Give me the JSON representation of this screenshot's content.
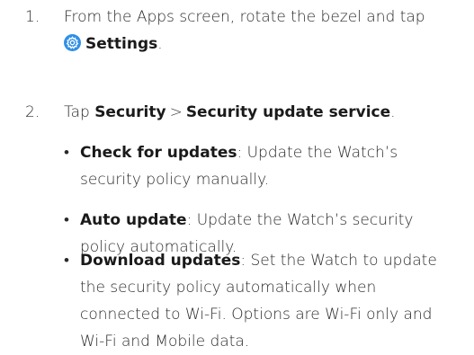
{
  "steps": [
    {
      "number": "1.",
      "text_before": "From the Apps screen, rotate the bezel and tap",
      "icon": "settings-gear-icon",
      "settings_label": "Settings",
      "text_after": "."
    },
    {
      "number": "2.",
      "text_before": "Tap",
      "security_label": "Security",
      "separator": ">",
      "security_update_label": "Security update service",
      "text_after": "."
    }
  ],
  "bullets": [
    {
      "marker": "•",
      "term": "Check for updates",
      "description": ": Update the Watch’s security policy manually."
    },
    {
      "marker": "•",
      "term": "Auto update",
      "description": ": Update the Watch’s security policy automatically."
    },
    {
      "marker": "•",
      "term": "Download updates",
      "description": ": Set the Watch to update the security policy automatically when connected to Wi-Fi. Options are Wi-Fi only and Wi-Fi and Mobile data."
    }
  ],
  "colors": {
    "text": "#2a2a2a",
    "icon_bg": "#2f8fe6"
  }
}
